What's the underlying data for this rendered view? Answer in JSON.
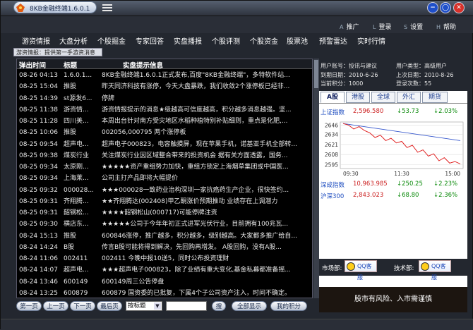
{
  "app": {
    "title": "8KB金融终端1.6.0.1"
  },
  "window_buttons": [
    "−",
    "◯",
    "✕"
  ],
  "top_links": [
    {
      "key": "A",
      "label": "推广"
    },
    {
      "key": "L",
      "label": "登录"
    },
    {
      "key": "S",
      "label": "设置"
    },
    {
      "key": "H",
      "label": "帮助"
    }
  ],
  "nav": [
    "游资情报",
    "大盘分析",
    "个股掘金",
    "专家回答",
    "实盘播报",
    "个股评测",
    "个股资金",
    "股票池",
    "预警雷达",
    "实时行情"
  ],
  "tagline": "游资情报：提供第一手游资消息",
  "table": {
    "headers": [
      "弹出时间",
      "标题",
      "实盘提示信息"
    ],
    "rows": [
      [
        "08-26 04:13",
        "1.6.0.1...",
        "8KB金融终端1.6.0.1正式发布,百度\"8KB金融终端\"，多特软件站..."
      ],
      [
        "08-25 15:04",
        "推股",
        "昨天同济科技有涨停，今天大盘暴跌，我们收敛2个涨停板已经非..."
      ],
      [
        "08-25 14:39",
        "st源发6...",
        "停牌"
      ],
      [
        "08-25 11:38",
        "游资情...",
        "游资情报提示的消息★级越高可信度越高，积分越多消息越强。坚..."
      ],
      [
        "08-25 11:28",
        "四川美...",
        "本周出台针对南方受灾地区水稻种植特别补贴细则，重点是化肥,..."
      ],
      [
        "08-25 10:06",
        "推股",
        "002056,000795  两个涨停板"
      ],
      [
        "08-25 09:54",
        "超声电...",
        "超声电子000823，电容触摸屏，现在苹果手机，诺基亚手机全部转..."
      ],
      [
        "08-25 09:38",
        "煤炭行业",
        "关注煤炭行业因区域整合带来的投资机会  据有关方面透露，国务..."
      ],
      [
        "08-25 09:34",
        "太原刚...",
        "★★★★★资产重组势力加快，重组方锁定上海烟草集团或中国医..."
      ],
      [
        "08-25 09:34",
        "上海莱...",
        "公司主打产品即将大幅提价"
      ],
      [
        "08-25 09:32",
        "000028...",
        "★★★000028一致药业治构深圳一家抗癌药生产企业，很快签约..."
      ],
      [
        "08-25 09:31",
        "齐翔腾...",
        "★★齐翔腾达(002408)甲乙酮涨价预期推动  业绩存在上调潜力"
      ],
      [
        "08-25 09:31",
        "韶钢松...",
        "★★★★韶钢松山(000717)可能停牌注资"
      ],
      [
        "08-25 09:30",
        "横店东...",
        "★★★★★公司于今年年初正式进军光伏行业，目前拥有100兆瓦..."
      ],
      [
        "08-24 15:13",
        "推股",
        "600846涨停，推广越多，积分越多，级别越高。大家都多推广给自..."
      ],
      [
        "08-24 14:24",
        "B股",
        "传言B股可能将得到解决，先回购再增发。                A股回购，没有A股..."
      ],
      [
        "08-24 11:06",
        "002411",
        "002411 今晚中报10送5，同时公布投资理财"
      ],
      [
        "08-24 14:07",
        "超声电...",
        "★★★超声电子000823，除了业绩有重大变化,基金私募都准备摇..."
      ],
      [
        "08-24 13:46",
        "600149",
        "600149周三公告停盘"
      ],
      [
        "08-24 13:25",
        "600879",
        "600879 国资委的已批复，下属4个子公司资产注入，时间不确定。"
      ]
    ]
  },
  "controls": {
    "first": "第一页",
    "prev": "上一页",
    "next": "下一页",
    "last": "最后页",
    "search_by": "按标题",
    "search_go": "搜",
    "show_all": "全部显示",
    "my_points": "我的积分"
  },
  "user": {
    "account_label": "用户账号：",
    "account": "投讯与建议",
    "type_label": "用户类型：",
    "type": "高级用户",
    "expire_label": "到期日期：",
    "expire": "2010-6-26",
    "last_login_label": "上次日期：",
    "last_login": "2010-8-26",
    "points_label": "当前积分：",
    "points": "1000",
    "days_label": "登录次数：",
    "days": "55"
  },
  "market_tabs": [
    "A股",
    "港股",
    "全球",
    "外汇",
    "期货"
  ],
  "indices": [
    {
      "name": "上证指数",
      "value": "2,596.580",
      "change": "↓53.73",
      "pct": "↓2.03%"
    },
    {
      "name": "深成指数",
      "value": "10,963.985",
      "change": "↓250.25",
      "pct": "↓2.23%"
    },
    {
      "name": "沪深300",
      "value": "2,843.023",
      "change": "↓68.80",
      "pct": "↓2.36%"
    }
  ],
  "chart_data": {
    "type": "line",
    "x_ticks": [
      "09:30",
      "11:30",
      "15:00"
    ],
    "y_ticks": [
      2646,
      2634,
      2621,
      2608,
      2595
    ],
    "series": [
      {
        "values": [
          2648,
          2646,
          2641,
          2644,
          2639,
          2636,
          2630,
          2633,
          2626,
          2629,
          2623,
          2625,
          2617,
          2620,
          2611,
          2614,
          2606,
          2609,
          2600,
          2604,
          2597,
          2599,
          2596
        ]
      }
    ],
    "ylim": [
      2590,
      2650
    ]
  },
  "contact": {
    "market_label": "市场部:",
    "tech_label": "技术部:",
    "qq_label": "QQ客服"
  },
  "warning": "股市有风险、入市需谨慎",
  "colors": {
    "up": "#ff3b3b",
    "down": "#0a8a0a",
    "value": "#cc2222",
    "header_blue": "#1a4abf"
  }
}
